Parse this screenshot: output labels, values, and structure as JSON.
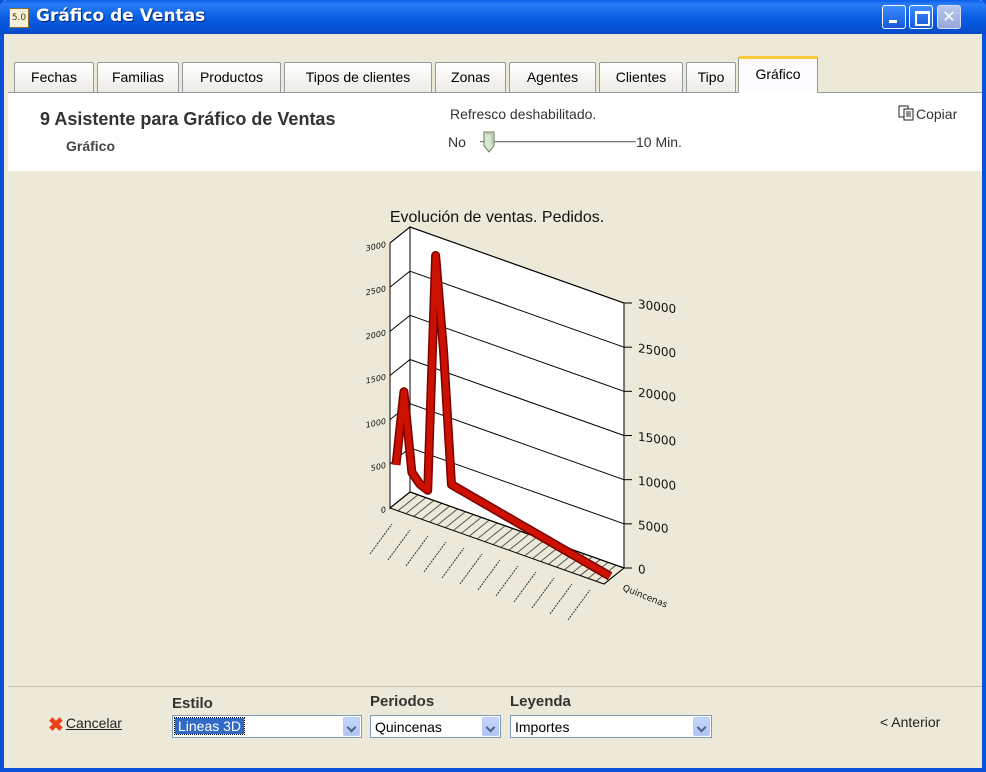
{
  "window": {
    "title": "Gráfico de Ventas",
    "icon_label": "5.0"
  },
  "tabs": [
    {
      "label": "Fechas"
    },
    {
      "label": "Familias"
    },
    {
      "label": "Productos"
    },
    {
      "label": "Tipos de clientes"
    },
    {
      "label": "Zonas"
    },
    {
      "label": "Agentes"
    },
    {
      "label": "Clientes"
    },
    {
      "label": "Tipo"
    },
    {
      "label": "Gráfico"
    }
  ],
  "active_tab": "Gráfico",
  "header": {
    "step_title": "9 Asistente para Gráfico de Ventas",
    "step_subtitle": "Gráfico",
    "refresh_label": "Refresco deshabilitado.",
    "slider_min_label": "No",
    "slider_max_label": "10 Min.",
    "copy_label": "Copiar"
  },
  "chart_data": {
    "type": "line",
    "style": "3d",
    "title": "Evolución de ventas. Pedidos.",
    "right_axis_ticks": [
      "0",
      "5000",
      "10000",
      "15000",
      "20000",
      "25000",
      "30000"
    ],
    "right_axis_range": [
      0,
      30000
    ],
    "left_axis_ticks": [
      "0",
      "500",
      "1000",
      "1500",
      "2000",
      "2500",
      "3000"
    ],
    "left_axis_range": [
      0,
      3000
    ],
    "depth_axis_label": "Quincenas",
    "series": [
      {
        "color": "#cc1100",
        "values": [
          4200,
          12800,
          4000,
          3000,
          2600,
          29500,
          19000,
          4200,
          4000,
          3800,
          3600,
          3400,
          3200,
          3000,
          2800,
          2600,
          2400,
          2200,
          2000,
          1800,
          1600,
          1400,
          1200,
          1000,
          800,
          600,
          400,
          200
        ]
      }
    ],
    "grid": true
  },
  "footer": {
    "cancel_label": "Cancelar",
    "estilo_label": "Estilo",
    "estilo_value": "Lineas 3D",
    "periodos_label": "Periodos",
    "periodos_value": "Quincenas",
    "leyenda_label": "Leyenda",
    "leyenda_value": "Importes",
    "prev_label": "< Anterior"
  }
}
